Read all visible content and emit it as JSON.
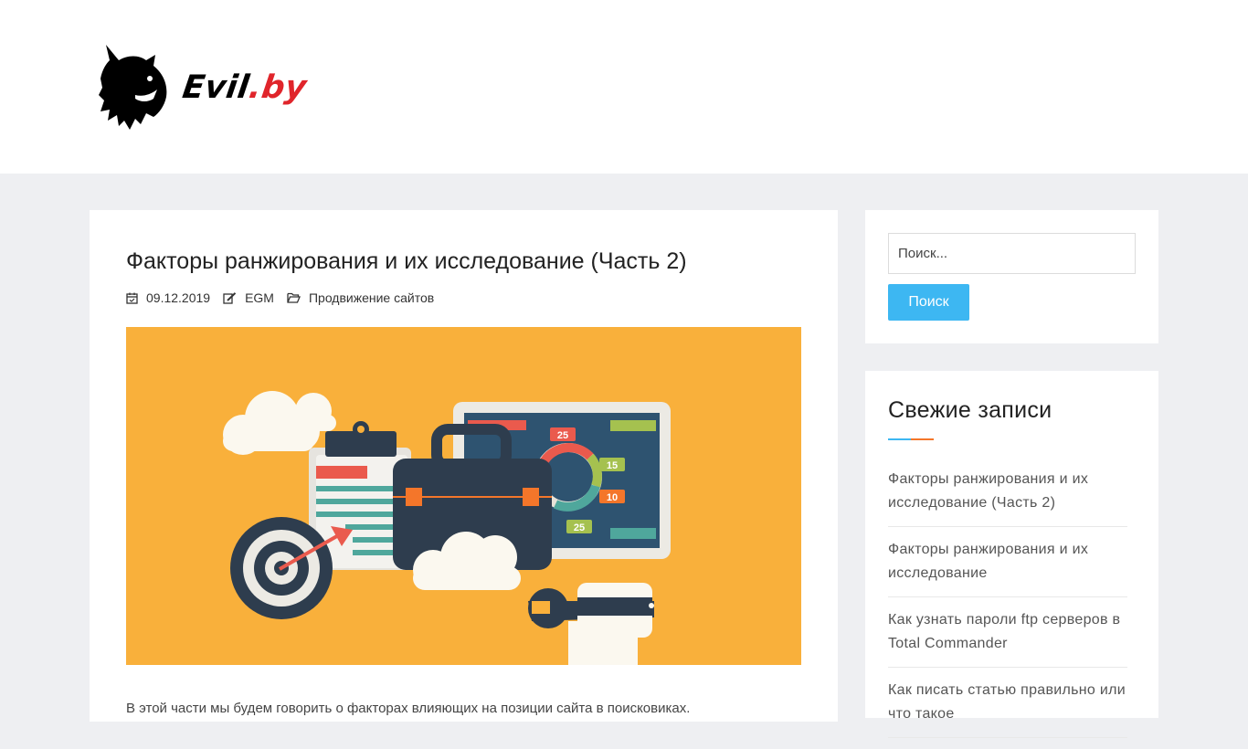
{
  "header": {
    "logo_text": "Evil",
    "logo_tld": ".by"
  },
  "article": {
    "title": "Факторы ранжирования и их исследование (Часть 2)",
    "date": "09.12.2019",
    "author": "EGM",
    "category": "Продвижение сайтов",
    "excerpt": "В этой части мы будем говорить о факторах влияющих на позиции сайта в поисковиках.",
    "image_labels": [
      "25",
      "15",
      "10",
      "25"
    ]
  },
  "sidebar": {
    "search": {
      "placeholder": "Поиск...",
      "button_label": "Поиск"
    },
    "recent_posts": {
      "title": "Свежие записи",
      "items": [
        {
          "label": "Факторы ранжирования и их исследование (Часть 2)"
        },
        {
          "label": "Факторы ранжирования и их исследование"
        },
        {
          "label": "Как узнать пароли ftp серверов в Total Commander"
        },
        {
          "label": "Как писать статью правильно или что такое"
        }
      ]
    }
  },
  "colors": {
    "accent_blue": "#3db7f2",
    "accent_orange": "#f4762a",
    "logo_red": "#e0252b",
    "image_background": "#f9b03b"
  }
}
